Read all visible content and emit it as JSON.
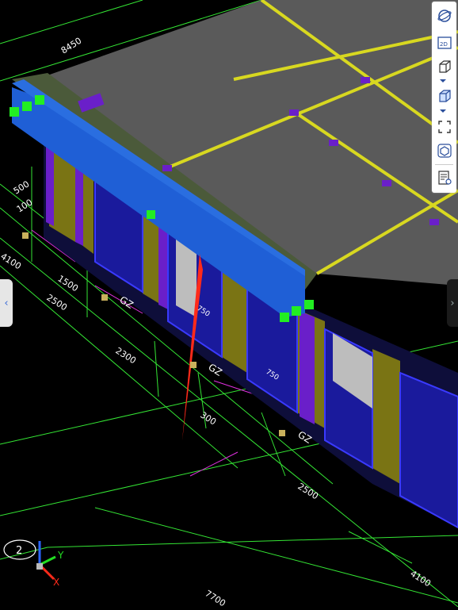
{
  "viewport": {
    "dimension_labels": [
      "8450",
      "500",
      "100",
      "4100",
      "1500",
      "2500",
      "2300",
      "300",
      "2500",
      "4100",
      "7700"
    ],
    "component_tags": [
      "GZ",
      "GZ",
      "GZ"
    ],
    "opening_labels": [
      "750",
      "750"
    ],
    "axis_number": "2",
    "axis_labels": {
      "y": "Y",
      "x": "X"
    },
    "colors": {
      "background": "#000000",
      "slab": "#5a5a5a",
      "beam": "#1f5fd6",
      "column": "#7a7414",
      "purple_column": "#6a1fc9",
      "window": "#1a1a9c",
      "gridline": "#34e534",
      "yellow_beam": "#d8d820",
      "grip": "#22ee22",
      "marker": "#ff2a1a"
    }
  },
  "toolbar": {
    "items": [
      "orbit-icon",
      "2d-view-icon",
      "cube-wireframe-icon",
      "cube-solid-icon",
      "selection-box-icon",
      "component-view-icon",
      "properties-list-icon"
    ],
    "view_2d_label": "2D"
  },
  "side_handles": {
    "left": "‹",
    "right": "›"
  }
}
